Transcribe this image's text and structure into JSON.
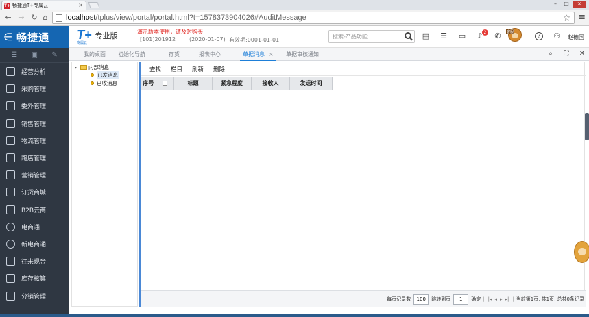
{
  "browser": {
    "tab_title": "畅捷通T+专属云",
    "favicon_text": "T+",
    "url_host": "localhost",
    "url_path": "/tplus/view/portal/portal.html?t=1578373904026#AuditMessage"
  },
  "header": {
    "brand": "畅捷通",
    "product_logo": "T+",
    "product_logo_sub": "专属云",
    "edition": "专业版",
    "demo_warning": "演示版本使用，请及时购买",
    "account_id": "[101]201912",
    "account_date": "(2020-01-07)",
    "validity": "有效期:0001-01-01",
    "search_placeholder": "搜索-产品功能",
    "notification_count": "2",
    "mascot_label": "客服",
    "user_name": "赵德国"
  },
  "sidebar": {
    "items": [
      {
        "label": "经营分析",
        "icon": "chart-icon"
      },
      {
        "label": "采购管理",
        "icon": "cart-icon"
      },
      {
        "label": "委外管理",
        "icon": "outsource-icon"
      },
      {
        "label": "销售管理",
        "icon": "sales-icon"
      },
      {
        "label": "物流管理",
        "icon": "truck-icon"
      },
      {
        "label": "跑店管理",
        "icon": "store-visit-icon"
      },
      {
        "label": "营销管理",
        "icon": "marketing-icon"
      },
      {
        "label": "订货商城",
        "icon": "mall-icon"
      },
      {
        "label": "B2B云商",
        "icon": "b2b-icon"
      },
      {
        "label": "电商通",
        "icon": "ecommerce-icon"
      },
      {
        "label": "新电商通",
        "icon": "new-ecommerce-icon"
      },
      {
        "label": "往来现金",
        "icon": "cashflow-icon"
      },
      {
        "label": "库存核算",
        "icon": "inventory-icon"
      },
      {
        "label": "分销管理",
        "icon": "distribution-icon"
      }
    ]
  },
  "tabs": [
    {
      "label": "我的桌面"
    },
    {
      "label": "初始化导航"
    },
    {
      "label": "存货"
    },
    {
      "label": "报表中心"
    },
    {
      "label": "单据消息",
      "active": true,
      "close": "×"
    },
    {
      "label": "单据审核通知"
    }
  ],
  "tree": {
    "root": "内部消息",
    "children": [
      "已发消息",
      "已收消息"
    ]
  },
  "toolbar": {
    "query": "查找",
    "columns": "栏目",
    "refresh": "刷新",
    "delete": "删除"
  },
  "grid": {
    "columns": [
      "序号",
      "",
      "标题",
      "紧急程度",
      "接收人",
      "发送时间"
    ]
  },
  "pager": {
    "per_page_label": "每页记录数",
    "per_page_value": "100",
    "jump_label": "跳转到页",
    "jump_value": "1",
    "confirm": "确定",
    "status": "当前第1页, 共1页, 总共0条记录"
  }
}
